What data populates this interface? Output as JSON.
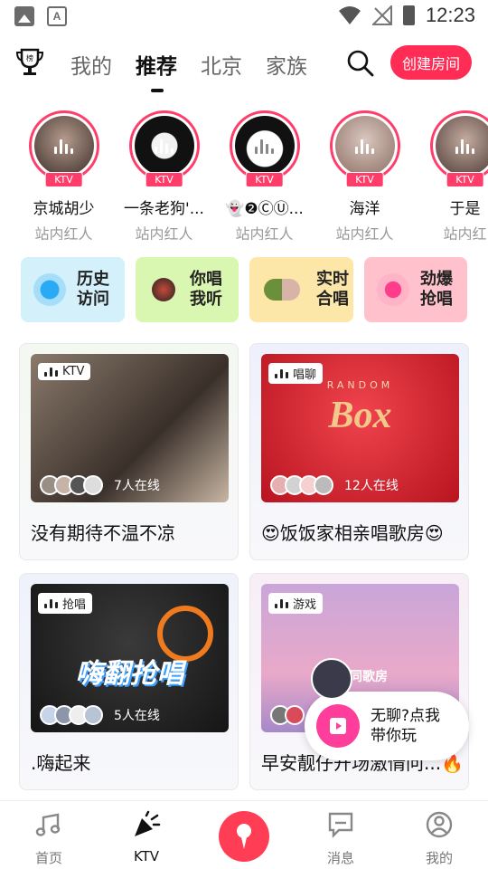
{
  "status_bar": {
    "time": "12:23"
  },
  "top_nav": {
    "tabs": [
      {
        "label": "我的"
      },
      {
        "label": "推荐"
      },
      {
        "label": "北京"
      },
      {
        "label": "家族"
      }
    ],
    "trophy_label": "榜",
    "create_room_label": "创建房间"
  },
  "users": [
    {
      "name": "京城胡少",
      "tag": "站内红人",
      "badge": "KTV"
    },
    {
      "name": "一条老狗'...",
      "tag": "站内红人",
      "badge": "KTV"
    },
    {
      "name": "👻❷ⒸⓊ...",
      "tag": "站内红人",
      "badge": "KTV"
    },
    {
      "name": "海洋",
      "tag": "站内红人",
      "badge": "KTV"
    },
    {
      "name": "于是",
      "tag": "站内红",
      "badge": "KTV"
    }
  ],
  "quick_entries": [
    {
      "label": "历史访问"
    },
    {
      "label": "你唱我听"
    },
    {
      "label": "实时合唱"
    },
    {
      "label": "劲爆抢唱"
    }
  ],
  "rooms": [
    {
      "type": "KTV",
      "online": "7人在线",
      "title": "没有期待不温不凉"
    },
    {
      "type": "唱聊",
      "online": "12人在线",
      "title": "😍饭饭家相亲唱歌房😍",
      "art_text": "Box",
      "art_sub": "RANDOM"
    },
    {
      "type": "抢唱",
      "online": "5人在线",
      "title": ".嗨起来",
      "art_text": "嗨翻抢唱"
    },
    {
      "type": "游戏",
      "online": "",
      "title": "早安靓仔开场激情问...🔥",
      "art_text": "爱家同歌房"
    }
  ],
  "popup": {
    "text_line1": "无聊?点我",
    "text_line2": "带你玩"
  },
  "bottom_nav": [
    {
      "label": "首页"
    },
    {
      "label": "KTV"
    },
    {
      "label": ""
    },
    {
      "label": "消息"
    },
    {
      "label": "我的"
    }
  ],
  "colors": {
    "accent": "#ff2d55",
    "badge": "#ff3d6a"
  }
}
